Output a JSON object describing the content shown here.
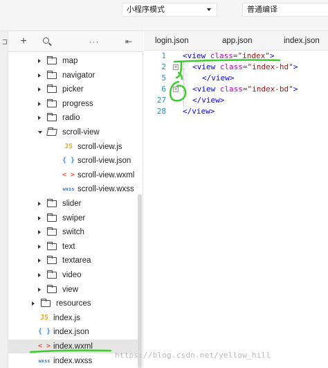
{
  "toolbar": {
    "mode_select": "小程序模式",
    "compile_select": "普通编译"
  },
  "tree_toolbar": {
    "add_icon": "plus-icon",
    "search_icon": "search-icon",
    "more_icon": "more-icon",
    "collapse_icon": "collapse-icon"
  },
  "tree": {
    "items": [
      {
        "label": "map",
        "type": "folder",
        "state": "collapsed"
      },
      {
        "label": "navigator",
        "type": "folder",
        "state": "collapsed"
      },
      {
        "label": "picker",
        "type": "folder",
        "state": "collapsed"
      },
      {
        "label": "progress",
        "type": "folder",
        "state": "collapsed"
      },
      {
        "label": "radio",
        "type": "folder",
        "state": "collapsed"
      },
      {
        "label": "scroll-view",
        "type": "folder",
        "state": "expanded"
      },
      {
        "label": "scroll-view.js",
        "type": "file",
        "icon": "JS"
      },
      {
        "label": "scroll-view.json",
        "type": "file",
        "icon": "{ }"
      },
      {
        "label": "scroll-view.wxml",
        "type": "file",
        "icon": "< >"
      },
      {
        "label": "scroll-view.wxss",
        "type": "file",
        "icon": "wxss"
      },
      {
        "label": "slider",
        "type": "folder",
        "state": "collapsed"
      },
      {
        "label": "swiper",
        "type": "folder",
        "state": "collapsed"
      },
      {
        "label": "switch",
        "type": "folder",
        "state": "collapsed"
      },
      {
        "label": "text",
        "type": "folder",
        "state": "collapsed"
      },
      {
        "label": "textarea",
        "type": "folder",
        "state": "collapsed"
      },
      {
        "label": "video",
        "type": "folder",
        "state": "collapsed"
      },
      {
        "label": "view",
        "type": "folder",
        "state": "collapsed"
      },
      {
        "label": "resources",
        "type": "folder",
        "state": "collapsed"
      },
      {
        "label": "index.js",
        "type": "file",
        "icon": "JS"
      },
      {
        "label": "index.json",
        "type": "file",
        "icon": "{ }"
      },
      {
        "label": "index.wxml",
        "type": "file",
        "icon": "< >",
        "selected": true
      },
      {
        "label": "index.wxss",
        "type": "file",
        "icon": "wxss"
      }
    ]
  },
  "editor": {
    "tabs": [
      {
        "label": "login.json"
      },
      {
        "label": "app.json"
      },
      {
        "label": "index.json"
      }
    ],
    "lines": [
      {
        "num": "1",
        "tag_open": "<view ",
        "attr": "class=",
        "value": "\"index\"",
        "tag_close": ">"
      },
      {
        "num": "2",
        "tag_open": "<view ",
        "attr": "class=",
        "value": "\"index-hd\"",
        "tag_close": ">"
      },
      {
        "num": "5",
        "tag_open": "</view>",
        "attr": "",
        "value": "",
        "tag_close": ""
      },
      {
        "num": "6",
        "tag_open": "<view ",
        "attr": "class=",
        "value": "\"index-bd\"",
        "tag_close": ">"
      },
      {
        "num": "27",
        "tag_open": "</view>",
        "attr": "",
        "value": "",
        "tag_close": ""
      },
      {
        "num": "28",
        "tag_open": "</view>",
        "attr": "",
        "value": "",
        "tag_close": ""
      }
    ],
    "fold_markers": [
      "+",
      "+"
    ]
  },
  "watermark": "https://blog.csdn.net/yellow_hill",
  "colors": {
    "tag": "#0000ff",
    "attr": "#c100c1",
    "value": "#a31515",
    "line_number": "#2b91af",
    "annotation": "#3ecb2f"
  }
}
